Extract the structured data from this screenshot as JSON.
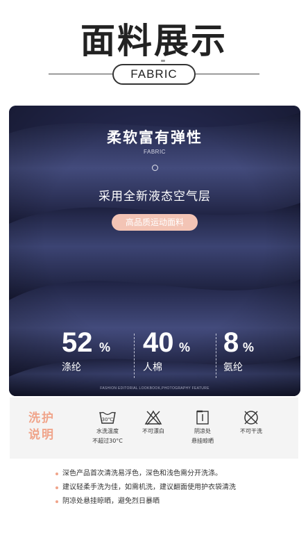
{
  "header": {
    "title": "面料展示",
    "subtitle": "FABRIC"
  },
  "fabric": {
    "feature_title": "柔软富有弹性",
    "feature_sub": "FABRIC",
    "air_layer": "采用全新液态空气层",
    "tag": "高品质运动面料",
    "stats": [
      {
        "value": "52",
        "unit": "%",
        "label": "涤纶"
      },
      {
        "value": "40",
        "unit": "%",
        "label": "人棉"
      },
      {
        "value": "8",
        "unit": "%",
        "label": "氨纶"
      }
    ],
    "lookbook": "FASHION EDITORIAL LOOKBOOK,PHOTOGRAPHY FEATURE",
    "colors": {
      "fabric": "#262a4c",
      "accent": "#f0a48a",
      "tag": "#f3c4b5"
    }
  },
  "care": {
    "title_line1": "洗护",
    "title_line2": "说明",
    "items": [
      {
        "icon": "wash-30-icon",
        "line1": "水洗温度",
        "line2": "不超过30°C",
        "symbol": "30℃"
      },
      {
        "icon": "no-bleach-icon",
        "line1": "不可漂白",
        "line2": ""
      },
      {
        "icon": "shade-dry-icon",
        "line1": "阴凉处",
        "line2": "悬挂晾晒"
      },
      {
        "icon": "no-dry-clean-icon",
        "line1": "不可干洗",
        "line2": ""
      }
    ]
  },
  "notes": [
    "深色产品首次清洗易浮色，深色和浅色需分开洗涤。",
    "建议轻柔手洗为佳，如需机洗，建议翻面使用护衣袋清洗",
    "阴凉处悬挂晾晒，避免烈日暴晒"
  ]
}
